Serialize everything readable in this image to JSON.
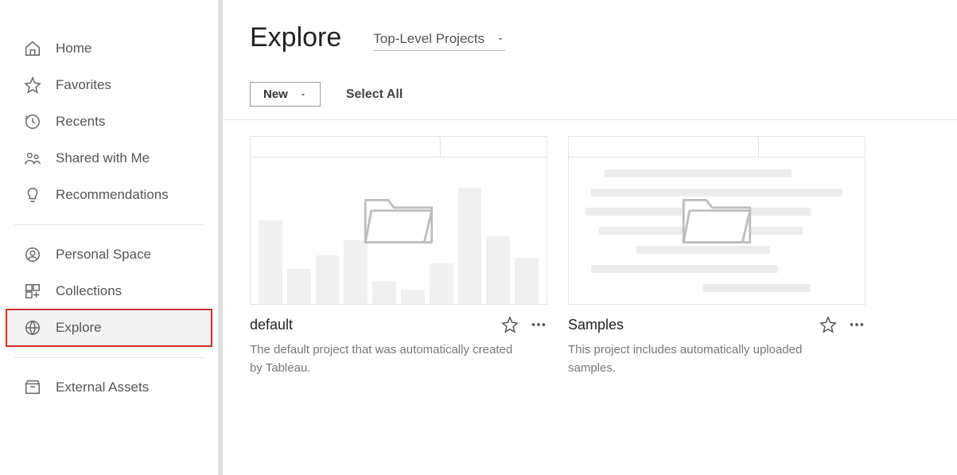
{
  "sidebar": {
    "items": [
      {
        "label": "Home",
        "icon": "home-icon"
      },
      {
        "label": "Favorites",
        "icon": "star-icon"
      },
      {
        "label": "Recents",
        "icon": "clock-icon"
      },
      {
        "label": "Shared with Me",
        "icon": "people-icon"
      },
      {
        "label": "Recommendations",
        "icon": "bulb-icon"
      }
    ],
    "items2": [
      {
        "label": "Personal Space",
        "icon": "person-icon"
      },
      {
        "label": "Collections",
        "icon": "grid-icon"
      },
      {
        "label": "Explore",
        "icon": "globe-icon",
        "active": true
      }
    ],
    "items3": [
      {
        "label": "External Assets",
        "icon": "box-icon"
      }
    ]
  },
  "header": {
    "title": "Explore",
    "breadcrumb": "Top-Level Projects"
  },
  "toolbar": {
    "new_label": "New",
    "select_all": "Select All"
  },
  "projects": [
    {
      "title": "default",
      "description": "The default project that was automatically created by Tableau.",
      "thumb_style": "bars"
    },
    {
      "title": "Samples",
      "description": "This project includes automatically uploaded samples.",
      "thumb_style": "lines"
    }
  ]
}
